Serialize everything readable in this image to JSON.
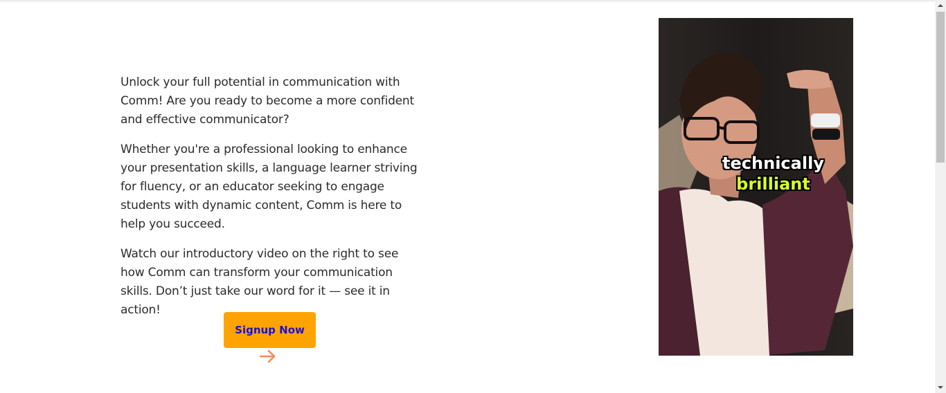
{
  "intro": {
    "paragraphs": [
      "Unlock your full potential in communication with Comm! Are you ready to become a more confident and effective communicator?",
      "Whether you're a professional looking to enhance your presentation skills, a language learner striving for fluency, or an educator seeking to engage students with dynamic content, Comm is here to help you succeed.",
      "Watch our introductory video on the right to see how Comm can transform your communication skills. Don’t just take our word for it — see it in action!"
    ]
  },
  "cta": {
    "label": "Signup Now",
    "button_color": "#ffa300",
    "label_color": "#1a10d6",
    "arrow_icon": "arrow-right-icon",
    "arrow_color": "#f58a5c"
  },
  "video": {
    "caption_line1": "technically",
    "caption_line2": "brilliant",
    "caption_highlight_color": "#d8ff2a"
  },
  "scrollbar": {
    "up_icon": "triangle-up-icon",
    "down_icon": "triangle-down-icon"
  }
}
